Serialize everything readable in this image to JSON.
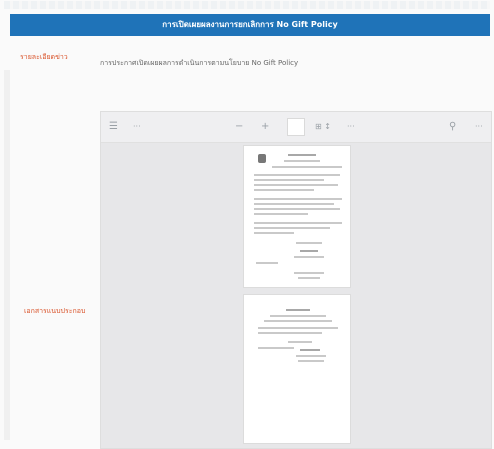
{
  "title_bar": {
    "text": "การเปิดเผยผลงานการยกเลิกการ No Gift Policy"
  },
  "labels": {
    "subject": "รายละเอียดข่าว",
    "attachment": "เอกสารแนบประกอบ"
  },
  "subject_value": "การประกาศเปิดเผยผลการดำเนินการตามนโยบาย No Gift Policy",
  "viewer": {
    "file_name": "···",
    "zoom_minus": "−",
    "zoom_plus": "+",
    "zoom_value": "",
    "fit_label": "⊞ ↕",
    "more_label": "···",
    "more_label_right": "···"
  },
  "colors": {
    "title_bar": "#1f73b8",
    "label_accent": "#d9532a"
  }
}
